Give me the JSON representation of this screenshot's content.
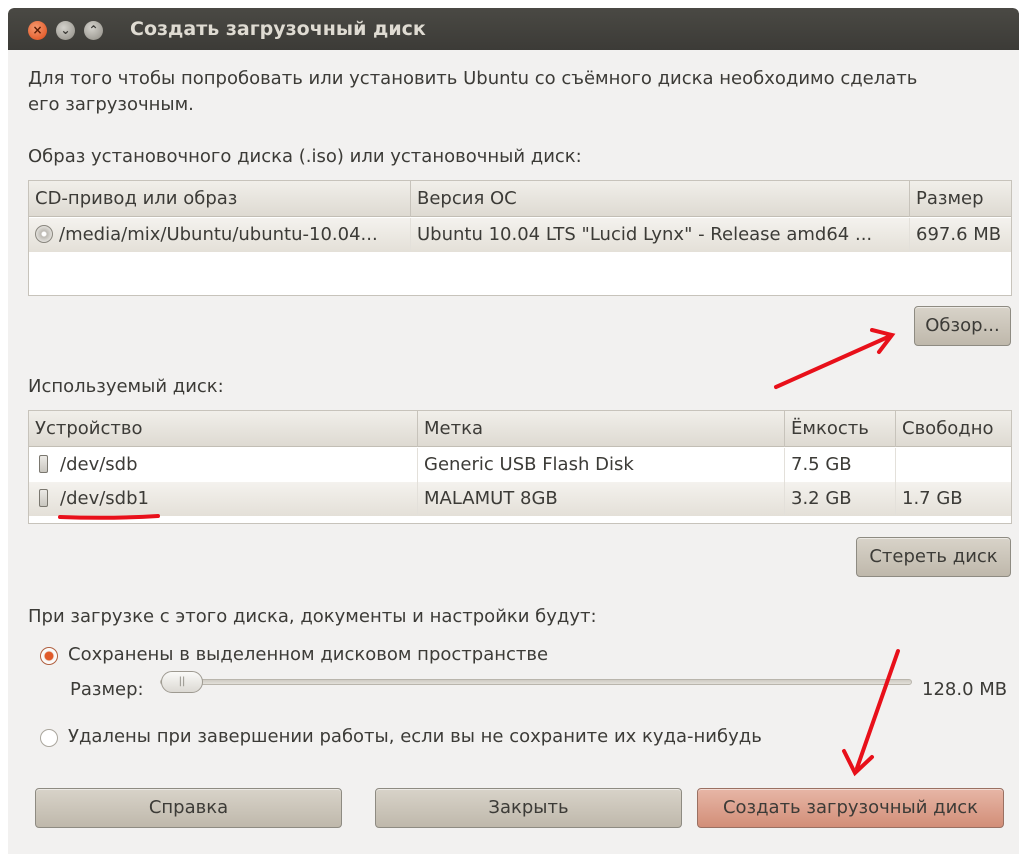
{
  "window": {
    "title": "Создать загрузочный диск",
    "close_glyph": "×",
    "min_glyph": "⌄",
    "max_glyph": "⌃"
  },
  "intro": {
    "line1": "Для того чтобы попробовать или установить Ubuntu со съёмного диска необходимо сделать",
    "line2": "его загрузочным."
  },
  "source": {
    "label": "Образ установочного диска (.iso) или установочный диск:",
    "columns": [
      "CD-привод или образ",
      "Версия ОС",
      "Размер"
    ],
    "rows": [
      {
        "icon": "cd-icon",
        "path": "/media/mix/Ubuntu/ubuntu-10.04...",
        "version": "Ubuntu 10.04 LTS \"Lucid Lynx\" - Release amd64 ...",
        "size": "697.6 MB"
      }
    ],
    "browse_label": "Обзор..."
  },
  "disk": {
    "label": "Используемый диск:",
    "columns": [
      "Устройство",
      "Метка",
      "Ёмкость",
      "Свободно"
    ],
    "rows": [
      {
        "icon": "usb-drive-icon",
        "device": "/dev/sdb",
        "label": "Generic USB Flash Disk",
        "capacity": "7.5 GB",
        "free": ""
      },
      {
        "icon": "usb-drive-icon",
        "device": "/dev/sdb1",
        "label": "MALAMUT 8GB",
        "capacity": "3.2 GB",
        "free": "1.7 GB"
      }
    ],
    "erase_label": "Стереть диск"
  },
  "persistence": {
    "label": "При загрузке с этого диска, документы и настройки будут:",
    "option_keep": "Сохранены в выделенном дисковом пространстве",
    "size_label": "Размер:",
    "size_value": "128.0 MB",
    "slider_fraction": 0.0,
    "option_discard": "Удалены при завершении работы, если вы не сохраните их куда-нибудь",
    "selected": "keep"
  },
  "buttons": {
    "help": "Справка",
    "close": "Закрыть",
    "create": "Создать загрузочный диск"
  },
  "colors": {
    "annotation": "#e8101a",
    "accent": "#e05a2a"
  }
}
